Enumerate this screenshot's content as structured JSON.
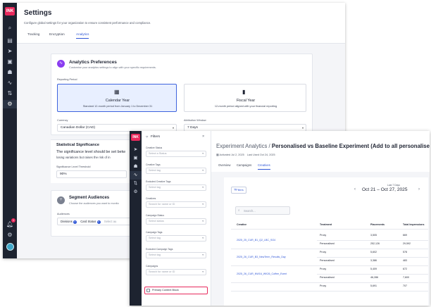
{
  "settings": {
    "sidebar": {
      "logo": "INK",
      "icons": [
        "search-icon",
        "layout-icon",
        "send-icon",
        "image-icon",
        "people-icon",
        "trending-icon",
        "flow-icon",
        "gear-icon"
      ],
      "bottom_icons": [
        "bell-icon",
        "cog-icon",
        "avatar"
      ],
      "notification_count": "1"
    },
    "title": "Settings",
    "subtitle": "Configure global settings for your organization to ensure consistent performance and compliance.",
    "tabs": [
      "Tracking",
      "Encryption",
      "Analytics"
    ],
    "active_tab": "Analytics",
    "analytics": {
      "heading": "Analytics Preferences",
      "description": "Customise your analytics settings to align with your specific requirements.",
      "reporting_period_label": "Reporting Period",
      "calendar": {
        "title": "Calendar Year",
        "desc": "Standard 12-month period from January 1 to December 31"
      },
      "fiscal": {
        "title": "Fiscal Year",
        "desc": "12-month period aligned with your financial reporting"
      },
      "currency_label": "Currency",
      "currency_value": "Canadian Dollar (CAD)",
      "attribution_label": "Attribution Window",
      "attribution_value": "7 Days"
    },
    "stat": {
      "heading": "Statistical Significance",
      "text_line1": "The significance level should be set betw",
      "text_line2": "losing variations but raises the risk of in",
      "confidence_label": "Significance Level Threshold",
      "confidence_value": "90%"
    },
    "segments": {
      "heading": "Segment Audiences",
      "description": "Choose the audiences you want to monito",
      "audiences_label": "Audiences",
      "chips": [
        "Divisions",
        "Card Status"
      ],
      "select_placeholder": "Select au"
    }
  },
  "experiment": {
    "sidebar": {
      "logo": "INK"
    },
    "filters": {
      "title": "Filters",
      "groups": [
        {
          "label": "Creative Status",
          "placeholder": "Select a Status"
        },
        {
          "label": "Creative Tags",
          "placeholder": "Select tag"
        },
        {
          "label": "Excluded Creative Tags",
          "placeholder": "Select tag"
        },
        {
          "label": "Creatives",
          "placeholder": "Search for name or ID"
        },
        {
          "label": "Campaign Status",
          "placeholder": "Select status"
        },
        {
          "label": "Campaign Tags",
          "placeholder": "Select tag"
        },
        {
          "label": "Excluded Campaign Tags",
          "placeholder": "Select tag"
        },
        {
          "label": "Campaigns",
          "placeholder": "Search for name or ID"
        }
      ],
      "primary_block_label": "Primary Content Block"
    },
    "breadcrumb_root": "Experiment Analytics",
    "breadcrumb_sep": "/",
    "title": "Personalised vs Baseline Experiment (Add to all personalised sends)",
    "activated": "Activated Jul 2, 2025",
    "last_used": "Last Used Oct 24, 2025",
    "tabs": [
      "Overview",
      "Campaigns",
      "Creatives"
    ],
    "active_tab": "Creatives",
    "filters_button": "Filters",
    "date_caption": "Last 7 Days",
    "date_range": "Oct 21 – Oct 27, 2025",
    "search_placeholder": "Search...",
    "table": {
      "headers": [
        "Creative",
        "Treatment",
        "Placements",
        "Total Impressions"
      ],
      "groups": [
        {
          "creative": "2025_25_CUR_B1_Q2_LBC_SG4",
          "rows": [
            {
              "treatment": "Proxy",
              "placements": "3,505",
              "impressions": "669"
            },
            {
              "treatment": "Personalised",
              "placements": "252,126",
              "impressions": "29,592"
            }
          ]
        },
        {
          "creative": "2025_26_CUR_B3_NewTerm_Results_Day",
          "rows": [
            {
              "treatment": "Proxy",
              "placements": "5,602",
              "impressions": "578"
            },
            {
              "treatment": "Personalised",
              "placements": "3,386",
              "impressions": "483"
            }
          ]
        },
        {
          "creative": "2025_26_CUR_NW16_WK26_Coffee_Event",
          "rows": [
            {
              "treatment": "Proxy",
              "placements": "5,409",
              "impressions": "672"
            },
            {
              "treatment": "Personalised",
              "placements": "46,286",
              "impressions": "7,600"
            }
          ]
        },
        {
          "creative": "",
          "rows": [
            {
              "treatment": "Proxy",
              "placements": "5,691",
              "impressions": "707"
            }
          ]
        }
      ]
    }
  },
  "colors": {
    "sidebar": "#1d2330",
    "accent": "#2f56d6",
    "brand": "#e8295c",
    "highlight_border": "#e8295c"
  }
}
